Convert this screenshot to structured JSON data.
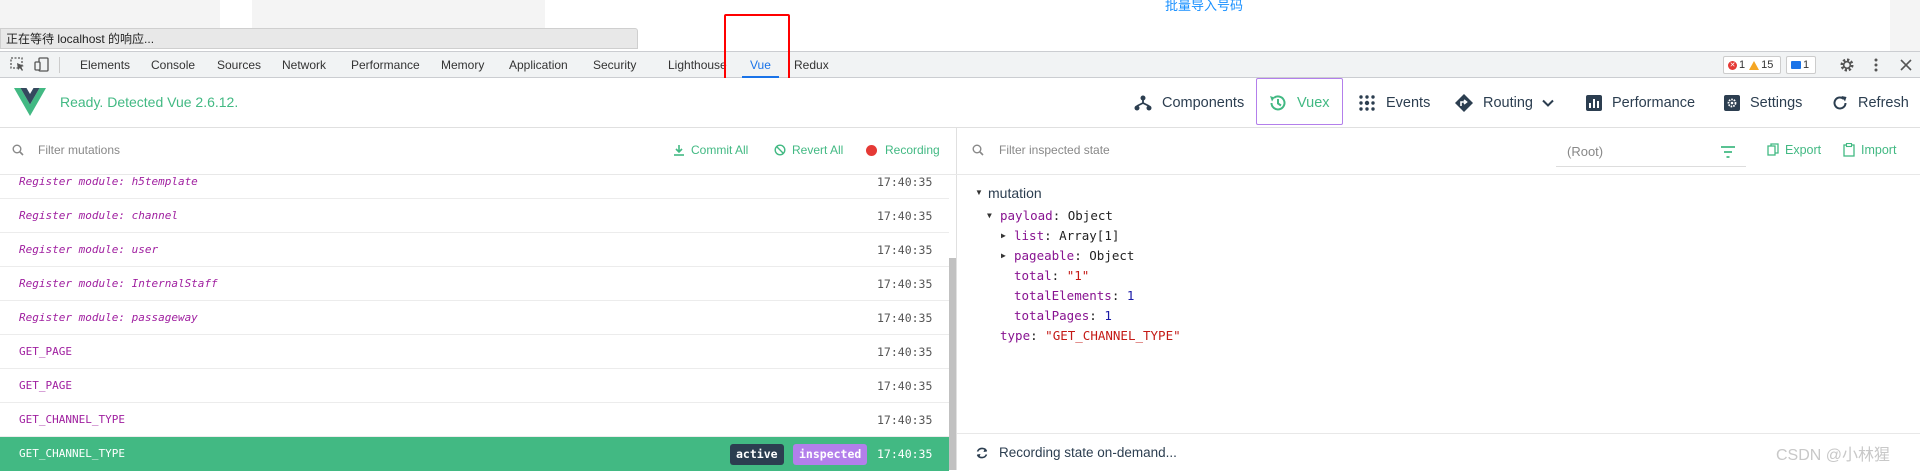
{
  "page": {
    "import_link": "批量导入号码",
    "status_tip": "正在等待 localhost 的响应..."
  },
  "devtools": {
    "tabs": [
      "Elements",
      "Console",
      "Sources",
      "Network",
      "Performance",
      "Memory",
      "Application",
      "Security",
      "Lighthouse",
      "Vue",
      "Redux"
    ],
    "active_tab": "Vue",
    "errors": "1",
    "warnings": "15",
    "messages": "1"
  },
  "vue": {
    "status": "Ready. Detected Vue 2.6.12.",
    "nav": {
      "components": "Components",
      "vuex": "Vuex",
      "events": "Events",
      "routing": "Routing",
      "performance": "Performance",
      "settings": "Settings",
      "refresh": "Refresh"
    },
    "active_nav": "Vuex",
    "accent_color": "#42b983"
  },
  "mutations": {
    "filter_placeholder": "Filter mutations",
    "commit_all": "Commit All",
    "revert_all": "Revert All",
    "recording": "Recording",
    "rows": [
      {
        "name": "Register module: h5template",
        "time": "17:40:35"
      },
      {
        "name": "Register module: channel",
        "time": "17:40:35"
      },
      {
        "name": "Register module: user",
        "time": "17:40:35"
      },
      {
        "name": "Register module: InternalStaff",
        "time": "17:40:35"
      },
      {
        "name": "Register module: passageway",
        "time": "17:40:35"
      },
      {
        "name": "GET_PAGE",
        "time": "17:40:35"
      },
      {
        "name": "GET_PAGE",
        "time": "17:40:35"
      },
      {
        "name": "GET_CHANNEL_TYPE",
        "time": "17:40:35"
      },
      {
        "name": "GET_CHANNEL_TYPE",
        "time": "17:40:35",
        "tag_active": "active",
        "tag_inspected": "inspected"
      }
    ]
  },
  "inspector": {
    "filter_placeholder": "Filter inspected state",
    "root_select": "(Root)",
    "export": "Export",
    "import": "Import",
    "section": "mutation",
    "payload_key": "payload",
    "payload_val": "Object",
    "list_key": "list",
    "list_val": "Array[1]",
    "pageable_key": "pageable",
    "pageable_val": "Object",
    "total_key": "total",
    "total_val": "\"1\"",
    "total_elements_key": "totalElements",
    "total_elements_val": "1",
    "total_pages_key": "totalPages",
    "total_pages_val": "1",
    "type_key": "type",
    "type_val": "\"GET_CHANNEL_TYPE\"",
    "footer": "Recording state on-demand..."
  },
  "watermark": "CSDN @小林猩"
}
